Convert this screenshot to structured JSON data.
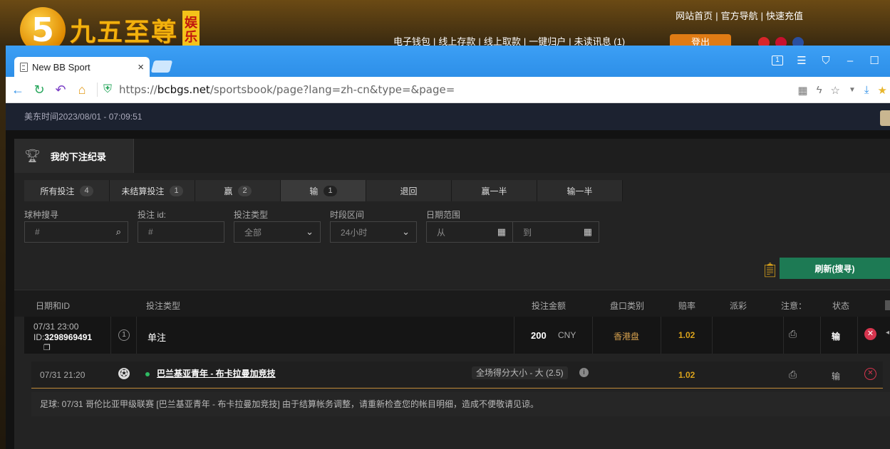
{
  "background_site": {
    "logo_digit": "5",
    "logo_text": "九五至尊",
    "logo_badge": "娱乐",
    "top_links": [
      "网站首页",
      "官方导航",
      "快速充值"
    ],
    "nav_links": [
      "电子钱包",
      "线上存款",
      "线上取款",
      "一键归户",
      "未读讯息 (1)"
    ],
    "logout_label": "登出"
  },
  "browser": {
    "tab_title": "New BB Sport",
    "url_scheme": "https://",
    "url_host": "bcbgs.net",
    "url_path": "/sportsbook/page?lang=zh-cn&type=&page=",
    "window_number": "1"
  },
  "page": {
    "time_label": "美东时间2023/08/01 - 07:09:51",
    "panel_title": "我的下注纪录",
    "tabs": [
      {
        "label": "所有投注",
        "count": "4"
      },
      {
        "label": "未结算投注",
        "count": "1"
      },
      {
        "label": "赢",
        "count": "2"
      },
      {
        "label": "输",
        "count": "1"
      },
      {
        "label": "退回",
        "count": ""
      },
      {
        "label": "赢一半",
        "count": ""
      },
      {
        "label": "输一半",
        "count": ""
      }
    ],
    "filters": {
      "sport_label": "球种搜寻",
      "sport_placeholder": "#",
      "betid_label": "投注 id:",
      "betid_placeholder": "#",
      "bettype_label": "投注类型",
      "bettype_value": "全部",
      "period_label": "时段区间",
      "period_value": "24小时",
      "date_label": "日期范围",
      "date_from": "从",
      "date_to": "到"
    },
    "refresh_label": "刷新(搜寻)",
    "columns": [
      "日期和ID",
      "投注类型",
      "投注金额",
      "盘口类别",
      "赔率",
      "派彩",
      "注意：",
      "状态"
    ],
    "bet": {
      "date": "07/31 23:00",
      "id_prefix": "ID:",
      "id": "3298969491",
      "parlay_count": "1",
      "type": "单注",
      "amount": "200",
      "currency": "CNY",
      "market": "香港盘",
      "odds": "1.02",
      "status": "输"
    },
    "selection": {
      "date": "07/31 21:20",
      "match": "巴兰基亚青年 - 布卡拉曼加竞技",
      "pick": "全场得分大小 - 大 (2.5)",
      "odds": "1.02",
      "status": "输"
    },
    "notice": "足球: 07/31 哥伦比亚甲级联赛 [巴兰基亚青年 - 布卡拉曼加竞技] 由于结算帐务调整，请重新检查您的帐目明细，造成不便敬请见谅。"
  }
}
